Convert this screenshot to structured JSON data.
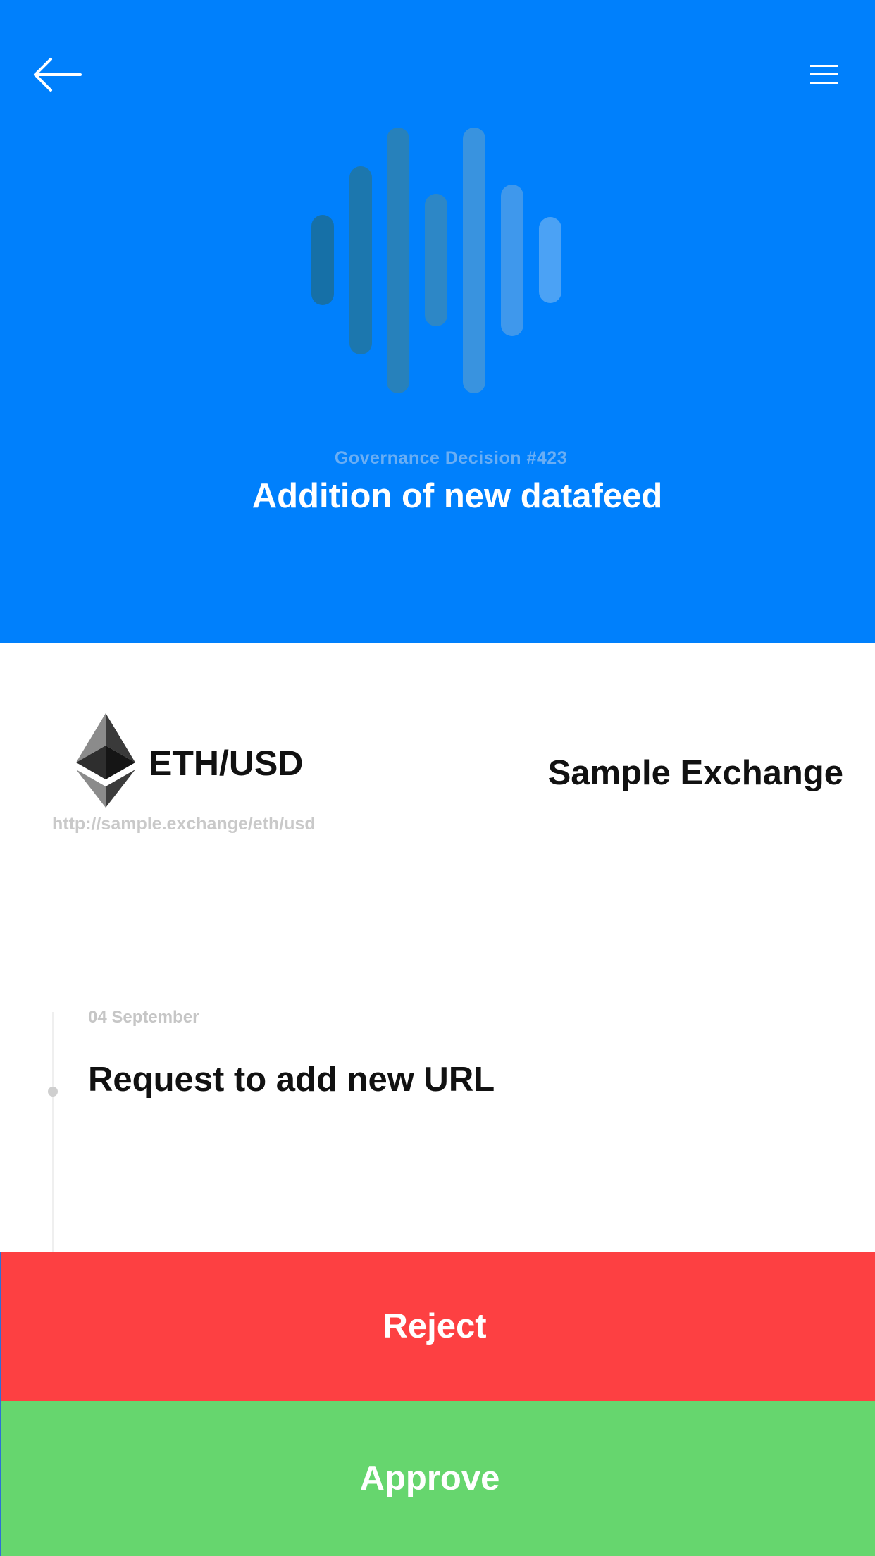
{
  "header": {
    "background_color": "#0080fc",
    "back_icon": "arrow-left-icon",
    "menu_icon": "hamburger-menu-icon",
    "decoration": "waveform-bars",
    "decision_number": "Governance Decision #423",
    "title": "Addition of new datafeed"
  },
  "feed": {
    "asset_icon": "ethereum-icon",
    "pair": "ETH/USD",
    "exchange": "Sample Exchange",
    "url": "http://sample.exchange/eth/usd"
  },
  "timeline": {
    "events": [
      {
        "date": "04 September",
        "title": "Request to add new URL"
      }
    ]
  },
  "actions": {
    "reject_label": "Reject",
    "reject_color": "#fd4042",
    "approve_label": "Approve",
    "approve_color": "#66d66e"
  }
}
